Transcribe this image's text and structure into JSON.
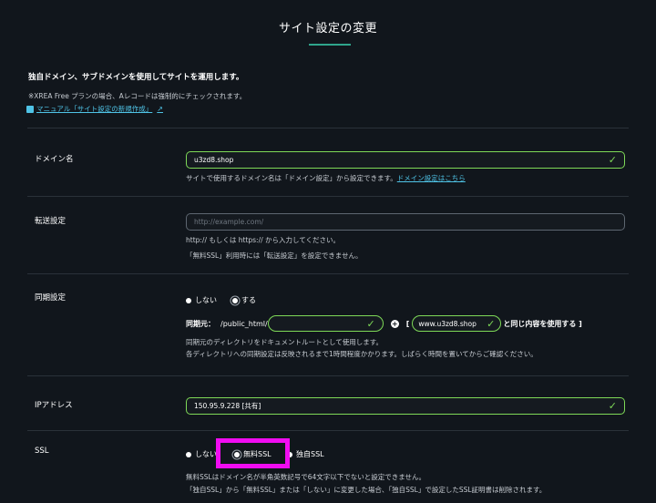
{
  "modal": {
    "title": "サイト設定の変更",
    "intro": "独自ドメイン、サブドメインを使用してサイトを運用します。",
    "note": "※XREA Free プランの場合、Aレコードは強制的にチェックされます。",
    "manual_link": "マニュアル「サイト設定の新規作成」"
  },
  "domain": {
    "label": "ドメイン名",
    "value": "u3zd8.shop",
    "help": "サイトで使用するドメイン名は「ドメイン設定」から設定できます。",
    "help_link": "ドメイン設定はこちら"
  },
  "redirect": {
    "label": "転送設定",
    "placeholder": "http://example.com/",
    "help1": "http:// もしくは https:// から入力してください。",
    "help2": "「無料SSL」利用時には「転送設定」を設定できません。"
  },
  "sync": {
    "label": "同期設定",
    "options": [
      "しない",
      "する"
    ],
    "selected": "する",
    "source_label": "同期元：",
    "source_path": "/public_html/",
    "bracket_open": "[",
    "domain_value": "www.u3zd8.shop",
    "suffix": "と同じ内容を使用する ]",
    "help1": "同期元のディレクトリをドキュメントルートとして使用します。",
    "help2": "各ディレクトリへの同期設定は反映されるまで1時間程度かかります。しばらく時間を置いてからご確認ください。"
  },
  "ip": {
    "label": "IPアドレス",
    "value": "150.95.9.228 [共有]"
  },
  "ssl": {
    "label": "SSL",
    "options": [
      "しない",
      "無料SSL",
      "独自SSL"
    ],
    "selected": "無料SSL",
    "help1": "無料SSLはドメイン名が半角英数記号で64文字以下でないと設定できません。",
    "help2": "「独自SSL」から「無料SSL」または「しない」に変更した場合、「独自SSL」で設定したSSL証明書は削除されます。"
  },
  "colors": {
    "accent": "#2fa58b",
    "valid": "#7ed957",
    "link": "#4fc3e6",
    "highlight": "#f10cf1"
  }
}
